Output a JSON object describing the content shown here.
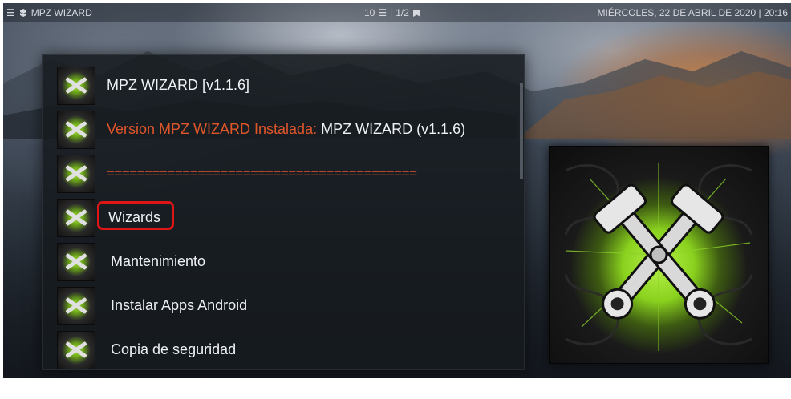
{
  "topbar": {
    "title": "MPZ WIZARD",
    "count": "10",
    "page": "1/2",
    "datetime": "MIÉRCOLES, 22 DE ABRIL DE 2020 | 20:16"
  },
  "list": {
    "items": [
      {
        "label": "MPZ WIZARD [v1.1.6]"
      },
      {
        "label_orange": "Version MPZ WIZARD  Instalada:",
        "label_white": " MPZ WIZARD (v1.1.6)"
      },
      {
        "label": "========================================="
      },
      {
        "label": "Wizards"
      },
      {
        "label": "Mantenimiento"
      },
      {
        "label": "Instalar Apps Android"
      },
      {
        "label": "Copia de seguridad"
      }
    ]
  },
  "colors": {
    "accent_orange": "#e0562b",
    "highlight_red": "#e01616",
    "neon_green": "#9be02f"
  },
  "icons": {
    "menu": "hamburger-icon",
    "addon": "addon-icon",
    "list": "list-icon",
    "flag": "flag-icon",
    "thumb": "piston-icon"
  }
}
